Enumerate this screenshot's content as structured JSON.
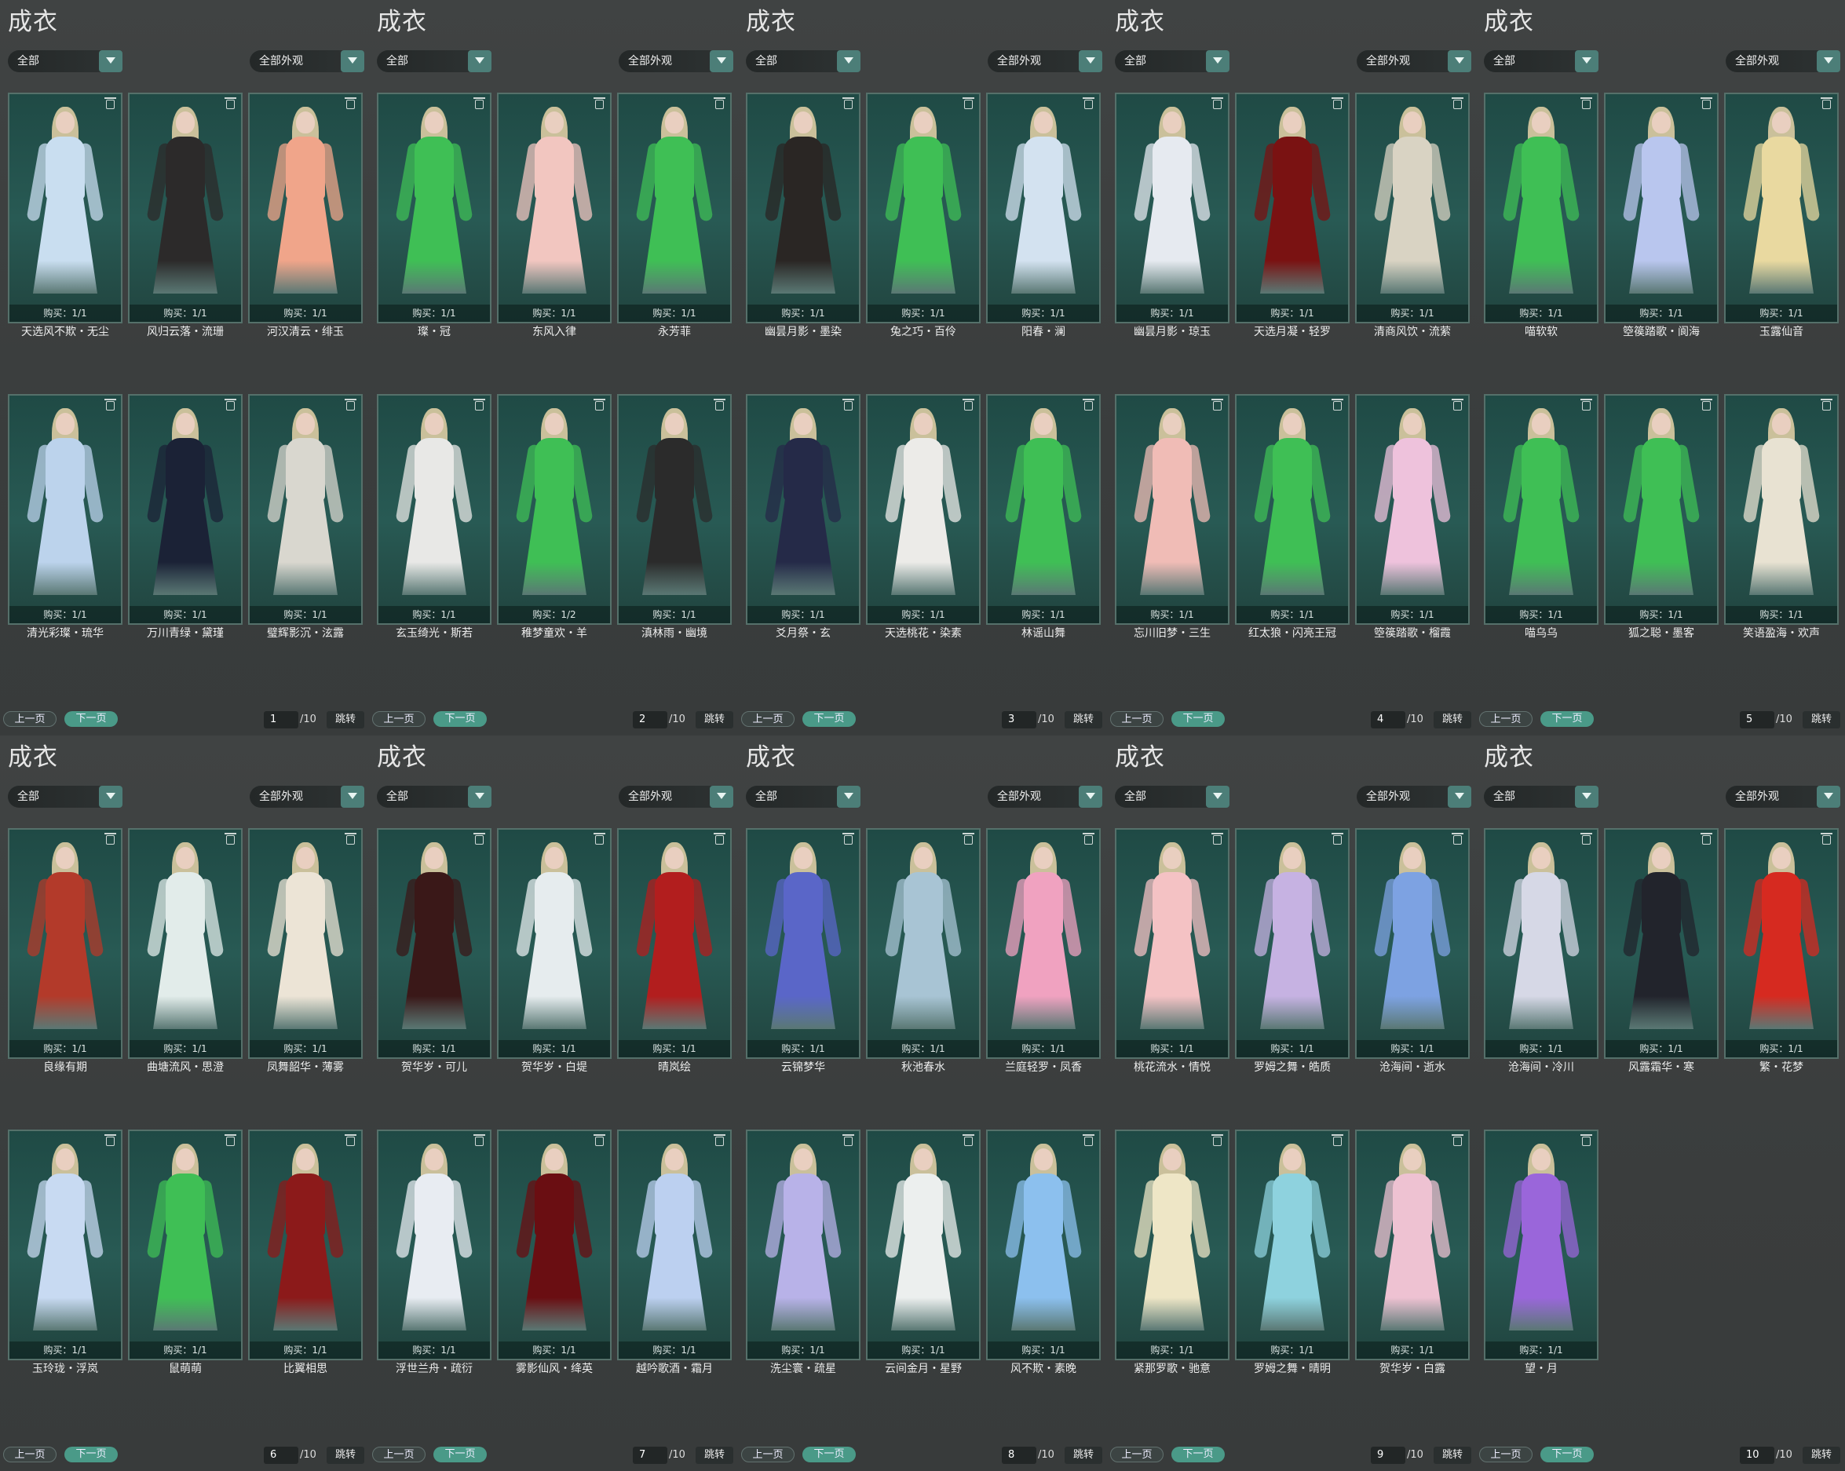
{
  "title": "成衣",
  "category_filter": "全部",
  "appearance_filter": "全部外观",
  "prev_label": "上一页",
  "next_label": "下一页",
  "jump_label": "跳转",
  "total_pages": "/10",
  "colors": {
    "accent": "#4a9a88",
    "card_bg": "#285a54",
    "panel_bg": "#3a3d3d"
  },
  "icons": {
    "trash": "trash-icon",
    "dropdown": "chevron-down-icon"
  },
  "pages": [
    {
      "page": "1",
      "items": [
        {
          "name": "天选风不欺・无尘",
          "purchase": "购买：1/1",
          "color": "#c9def0"
        },
        {
          "name": "风归云落・流珊",
          "purchase": "购买：1/1",
          "color": "#2c2a2a"
        },
        {
          "name": "河汉清云・绯玉",
          "purchase": "购买：1/1",
          "color": "#f0a58a"
        },
        {
          "name": "清光彩璨・琉华",
          "purchase": "购买：1/1",
          "color": "#bcd3ec"
        },
        {
          "name": "万川青绿・黛瑾",
          "purchase": "购买：1/1",
          "color": "#1b2236"
        },
        {
          "name": "璧辉影沉・泫露",
          "purchase": "购买：1/1",
          "color": "#d9d7cf"
        }
      ]
    },
    {
      "page": "2",
      "items": [
        {
          "name": "璨・冠",
          "purchase": "购买：1/1",
          "color": "#3fbf55"
        },
        {
          "name": "东风入律",
          "purchase": "购买：1/1",
          "color": "#f2c6c0"
        },
        {
          "name": "永芳菲",
          "purchase": "购买：1/1",
          "color": "#3fbf55"
        },
        {
          "name": "玄玉绮光・斯若",
          "purchase": "购买：1/1",
          "color": "#e8e8e6"
        },
        {
          "name": "稚梦童欢・羊",
          "purchase": "购买：1/2",
          "color": "#3fbf55"
        },
        {
          "name": "滇林雨・幽境",
          "purchase": "购买：1/1",
          "color": "#2b2b2b"
        }
      ]
    },
    {
      "page": "3",
      "items": [
        {
          "name": "幽昙月影・墨染",
          "purchase": "购买：1/1",
          "color": "#2a2624"
        },
        {
          "name": "兔之巧・百伶",
          "purchase": "购买：1/1",
          "color": "#3fbf55"
        },
        {
          "name": "阳春・澜",
          "purchase": "购买：1/1",
          "color": "#d3e2f0"
        },
        {
          "name": "爻月祭・玄",
          "purchase": "购买：1/1",
          "color": "#252a48"
        },
        {
          "name": "天选桃花・染素",
          "purchase": "购买：1/1",
          "color": "#ecebe8"
        },
        {
          "name": "林谣山舞",
          "purchase": "购买：1/1",
          "color": "#3fbf55"
        }
      ]
    },
    {
      "page": "4",
      "items": [
        {
          "name": "幽昙月影・琼玉",
          "purchase": "购买：1/1",
          "color": "#e6eaf0"
        },
        {
          "name": "天选月凝・轻罗",
          "purchase": "购买：1/1",
          "color": "#7a1212"
        },
        {
          "name": "清商风饮・流萦",
          "purchase": "购买：1/1",
          "color": "#d9d3c3"
        },
        {
          "name": "忘川旧梦・三生",
          "purchase": "购买：1/1",
          "color": "#f0bcb6"
        },
        {
          "name": "红太狼・闪亮王冠",
          "purchase": "购买：1/1",
          "color": "#3fbf55"
        },
        {
          "name": "箜篌踏歌・榴霞",
          "purchase": "购买：1/1",
          "color": "#eec2dc"
        }
      ]
    },
    {
      "page": "5",
      "items": [
        {
          "name": "喵软软",
          "purchase": "购买：1/1",
          "color": "#3fbf55"
        },
        {
          "name": "箜篌踏歌・阆海",
          "purchase": "购买：1/1",
          "color": "#b9c6ee"
        },
        {
          "name": "玉露仙音",
          "purchase": "购买：1/1",
          "color": "#e9d9a0"
        },
        {
          "name": "喵乌乌",
          "purchase": "购买：1/1",
          "color": "#3fbf55"
        },
        {
          "name": "狐之聪・墨客",
          "purchase": "购买：1/1",
          "color": "#3fbf55"
        },
        {
          "name": "笑语盈海・欢声",
          "purchase": "购买：1/1",
          "color": "#e8e2d2"
        }
      ]
    },
    {
      "page": "6",
      "items": [
        {
          "name": "良缘有期",
          "purchase": "购买：1/1",
          "color": "#b33a2a"
        },
        {
          "name": "曲塘流风・思澄",
          "purchase": "购买：1/1",
          "color": "#e2ecea"
        },
        {
          "name": "凤舞韶华・薄雾",
          "purchase": "购买：1/1",
          "color": "#ece4d6"
        },
        {
          "name": "玉玲珑・浮岚",
          "purchase": "购买：1/1",
          "color": "#c8daf2"
        },
        {
          "name": "鼠萌萌",
          "purchase": "购买：1/1",
          "color": "#3fbf55"
        },
        {
          "name": "比翼相思",
          "purchase": "购买：1/1",
          "color": "#8c1a1a"
        }
      ]
    },
    {
      "page": "7",
      "items": [
        {
          "name": "贺华岁・可儿",
          "purchase": "购买：1/1",
          "color": "#3a1818"
        },
        {
          "name": "贺华岁・白堤",
          "purchase": "购买：1/1",
          "color": "#e6ecee"
        },
        {
          "name": "晴岚绘",
          "purchase": "购买：1/1",
          "color": "#b21e1e"
        },
        {
          "name": "浮世兰舟・疏衍",
          "purchase": "购买：1/1",
          "color": "#e8ecf2"
        },
        {
          "name": "雾影仙风・绛英",
          "purchase": "购买：1/1",
          "color": "#6a0e12"
        },
        {
          "name": "越吟歌酒・霜月",
          "purchase": "购买：1/1",
          "color": "#bcd0f0"
        }
      ]
    },
    {
      "page": "8",
      "items": [
        {
          "name": "云锦梦华",
          "purchase": "购买：1/1",
          "color": "#5a66c8"
        },
        {
          "name": "秋池春水",
          "purchase": "购买：1/1",
          "color": "#a8c4d4"
        },
        {
          "name": "兰庭轻罗・凤香",
          "purchase": "购买：1/1",
          "color": "#f0a2c0"
        },
        {
          "name": "洗尘寰・疏星",
          "purchase": "购买：1/1",
          "color": "#b8b2e8"
        },
        {
          "name": "云间金月・星野",
          "purchase": "购买：1/1",
          "color": "#ecefee"
        },
        {
          "name": "风不欺・素晚",
          "purchase": "购买：1/1",
          "color": "#8cc0ee"
        }
      ]
    },
    {
      "page": "9",
      "items": [
        {
          "name": "桃花流水・情悦",
          "purchase": "购买：1/1",
          "color": "#f4c2c4"
        },
        {
          "name": "罗姆之舞・皓质",
          "purchase": "购买：1/1",
          "color": "#c6b2e2"
        },
        {
          "name": "沧海间・逝水",
          "purchase": "购买：1/1",
          "color": "#7da2e2"
        },
        {
          "name": "紧那罗歌・驰意",
          "purchase": "购买：1/1",
          "color": "#eee6c6"
        },
        {
          "name": "罗姆之舞・晴明",
          "purchase": "购买：1/1",
          "color": "#8ed2de"
        },
        {
          "name": "贺华岁・白露",
          "purchase": "购买：1/1",
          "color": "#eec2d2"
        }
      ]
    },
    {
      "page": "10",
      "items": [
        {
          "name": "沧海间・冷川",
          "purchase": "购买：1/1",
          "color": "#d6d8e6"
        },
        {
          "name": "风露霜华・寒",
          "purchase": "购买：1/1",
          "color": "#22242c"
        },
        {
          "name": "繁・花梦",
          "purchase": "购买：1/1",
          "color": "#d62a20"
        },
        {
          "name": "望・月",
          "purchase": "购买：1/1",
          "color": "#9a66da"
        }
      ]
    }
  ]
}
